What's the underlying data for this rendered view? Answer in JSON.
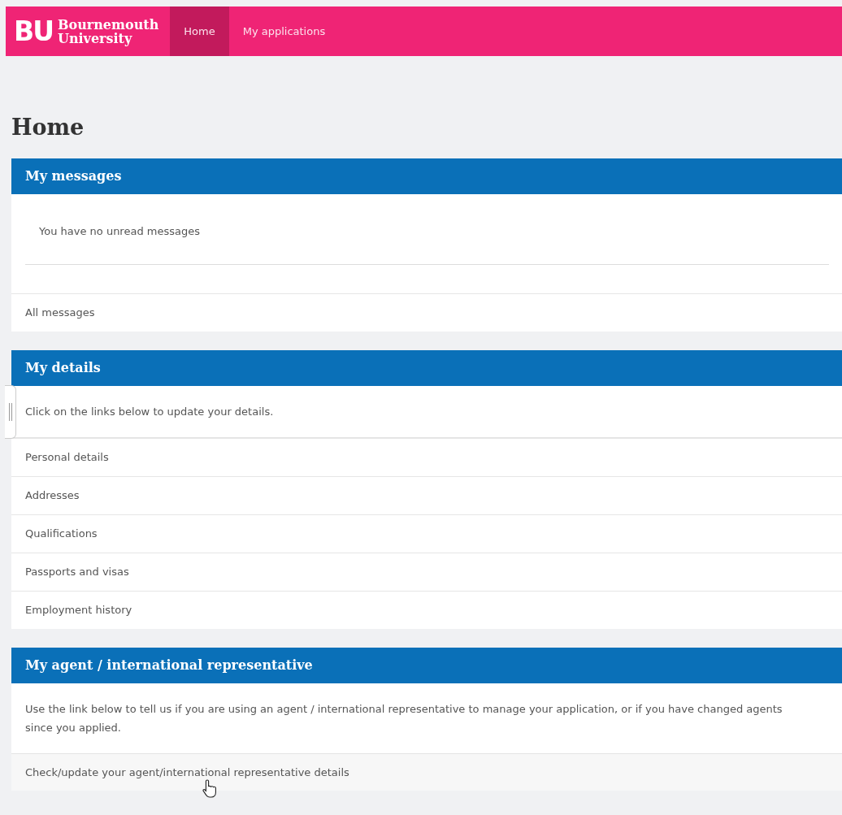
{
  "header": {
    "logo_letters": "BU",
    "logo_name": [
      "Bournemouth",
      "University"
    ],
    "nav": [
      {
        "label": "Home",
        "selected": true
      },
      {
        "label": "My applications",
        "selected": false
      }
    ]
  },
  "page_title": "Home",
  "panels": [
    {
      "kind": "messages",
      "heading": "My messages",
      "message": "You have no unread messages",
      "links": [
        "All messages"
      ]
    },
    {
      "kind": "links",
      "heading": "My details",
      "intro": "Click on the links below to update your details.",
      "links": [
        "Personal details",
        "Addresses",
        "Qualifications",
        "Passports and visas",
        "Employment history"
      ]
    },
    {
      "kind": "action",
      "heading": "My agent / international representative",
      "intro": "Use the link below to tell us if you are using an agent / international representative to manage your application, or if you have changed agents since you applied.",
      "links": [
        "Check/update your agent/international representative details"
      ]
    }
  ]
}
